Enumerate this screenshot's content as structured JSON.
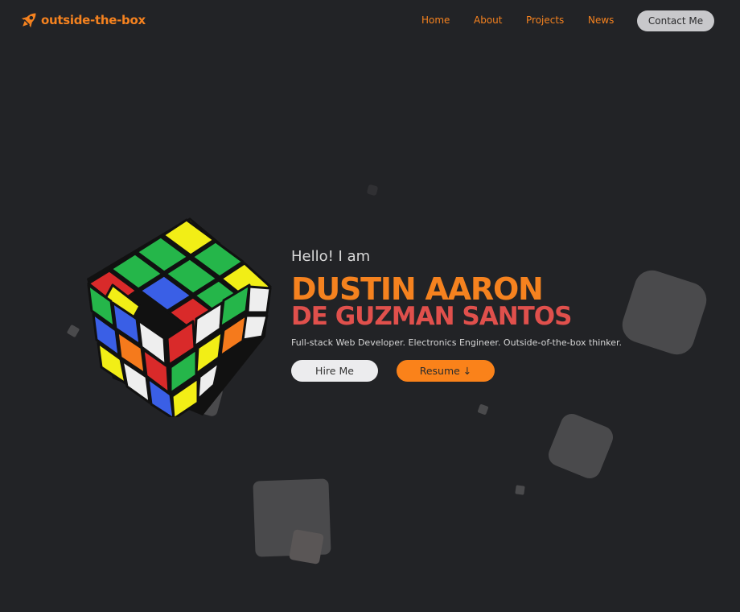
{
  "brand": {
    "name": "outside-the-box",
    "icon": "rocket-icon",
    "color": "#f5821f"
  },
  "nav": {
    "links": [
      "Home",
      "About",
      "Projects",
      "News"
    ],
    "contact_label": "Contact Me"
  },
  "hero": {
    "greeting": "Hello! I am",
    "name_line1": "DUSTIN AARON",
    "name_line2": "DE GUZMAN SANTOS",
    "tagline": "Full-stack Web Developer. Electronics Engineer. Outside-of-the-box thinker.",
    "hire_label": "Hire Me",
    "resume_label": "Resume ↓",
    "image_icon": "rubiks-cube-icon"
  },
  "colors": {
    "background": "#222326",
    "accent": "#f5821f",
    "name_secondary": "#e0504c",
    "decor_shape": "#4a4a4c"
  }
}
